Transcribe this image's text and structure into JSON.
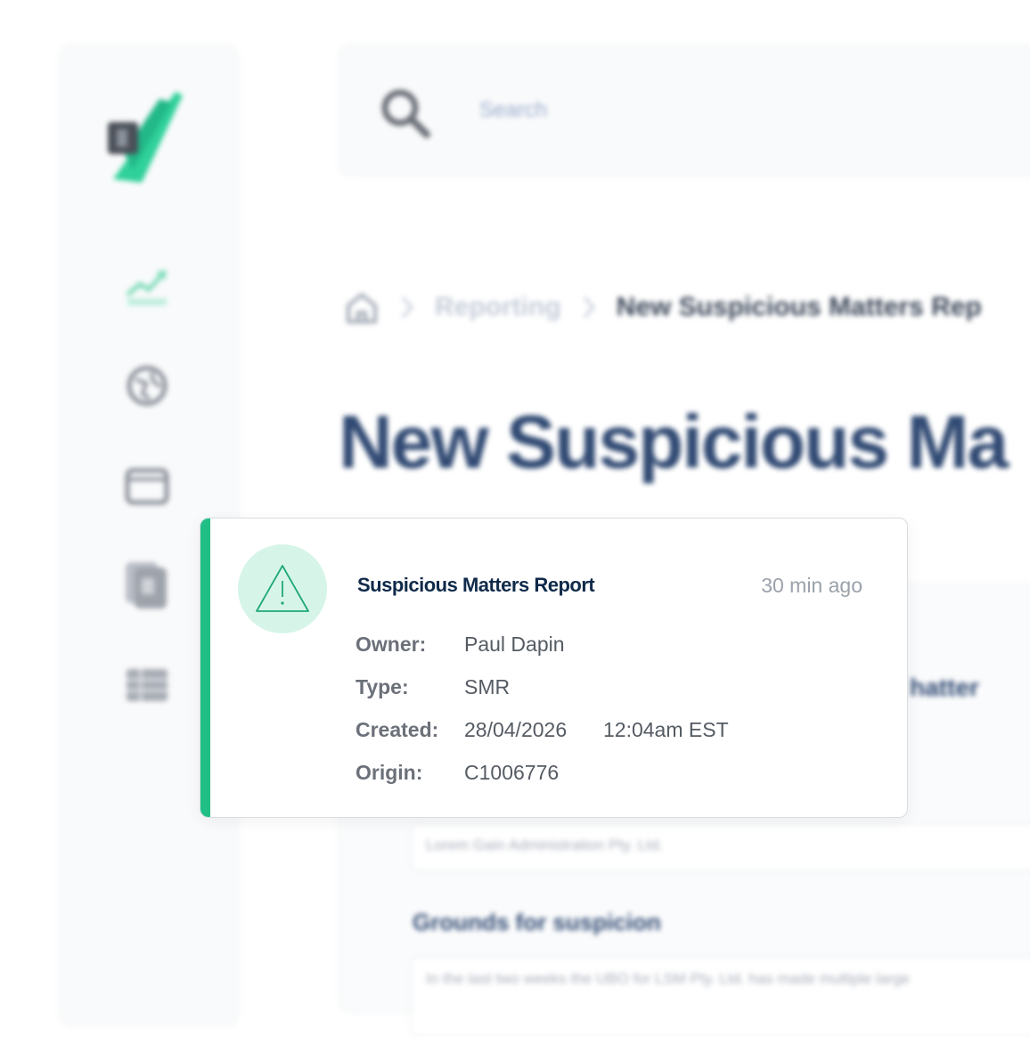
{
  "colors": {
    "accent": "#1fbf86",
    "accent_light": "#d6f5e8",
    "title_navy": "#0f2a4a"
  },
  "search": {
    "placeholder": "Search",
    "icon": "search-icon"
  },
  "breadcrumb": {
    "home_icon": "home-icon",
    "items": [
      "Reporting",
      "New Suspicious Matters Rep"
    ]
  },
  "page": {
    "title": "New Suspicious Ma"
  },
  "form": {
    "heading_partial": "hatter",
    "entity_value": "Lorem Gain Administration Pty. Ltd.",
    "grounds_heading": "Grounds for suspicion",
    "grounds_text": "In the last two weeks the UBO for LSM Pty. Ltd. has made multiple large"
  },
  "sidebar": {
    "items": [
      "chart-icon",
      "globe-icon",
      "folder-icon",
      "documents-icon",
      "table-icon"
    ]
  },
  "notification": {
    "icon": "warning-icon",
    "title": "Suspicious Matters Report",
    "time": "30 min ago",
    "owner_label": "Owner:",
    "owner_value": "Paul Dapin",
    "type_label": "Type:",
    "type_value": "SMR",
    "created_label": "Created:",
    "created_date": "28/04/2026",
    "created_time": "12:04am EST",
    "origin_label": "Origin:",
    "origin_value": "C1006776"
  }
}
